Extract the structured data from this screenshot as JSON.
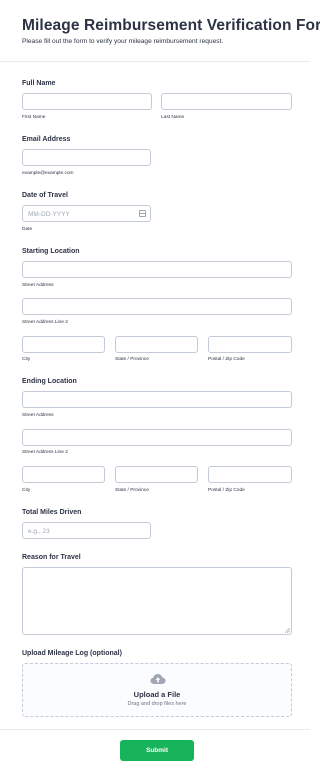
{
  "header": {
    "title": "Mileage Reimbursement Verification Form",
    "subtitle": "Please fill out the form to verify your mileage reimbursement request."
  },
  "full_name": {
    "label": "Full Name",
    "first_sublabel": "First Name",
    "last_sublabel": "Last Name",
    "first_value": "",
    "last_value": ""
  },
  "email": {
    "label": "Email Address",
    "value": "",
    "sublabel": "example@example.com"
  },
  "date_of_travel": {
    "label": "Date of Travel",
    "placeholder": "MM-DD-YYYY",
    "sublabel": "Date",
    "icon": "calendar-icon"
  },
  "starting_location": {
    "label": "Starting Location",
    "street_sublabel": "Street Address",
    "street2_sublabel": "Street Address Line 2",
    "city_sublabel": "City",
    "state_sublabel": "State / Province",
    "postal_sublabel": "Postal / Zip Code"
  },
  "ending_location": {
    "label": "Ending Location",
    "street_sublabel": "Street Address",
    "street2_sublabel": "Street Address Line 2",
    "city_sublabel": "City",
    "state_sublabel": "State / Province",
    "postal_sublabel": "Postal / Zip Code"
  },
  "total_miles": {
    "label": "Total Miles Driven",
    "placeholder": "e.g., 23"
  },
  "reason": {
    "label": "Reason for Travel",
    "value": ""
  },
  "upload": {
    "label": "Upload Mileage Log (optional)",
    "title": "Upload a File",
    "subtitle": "Drag and drop files here",
    "icon": "cloud-upload-icon"
  },
  "submit": {
    "label": "Submit",
    "color": "#18b45b"
  }
}
